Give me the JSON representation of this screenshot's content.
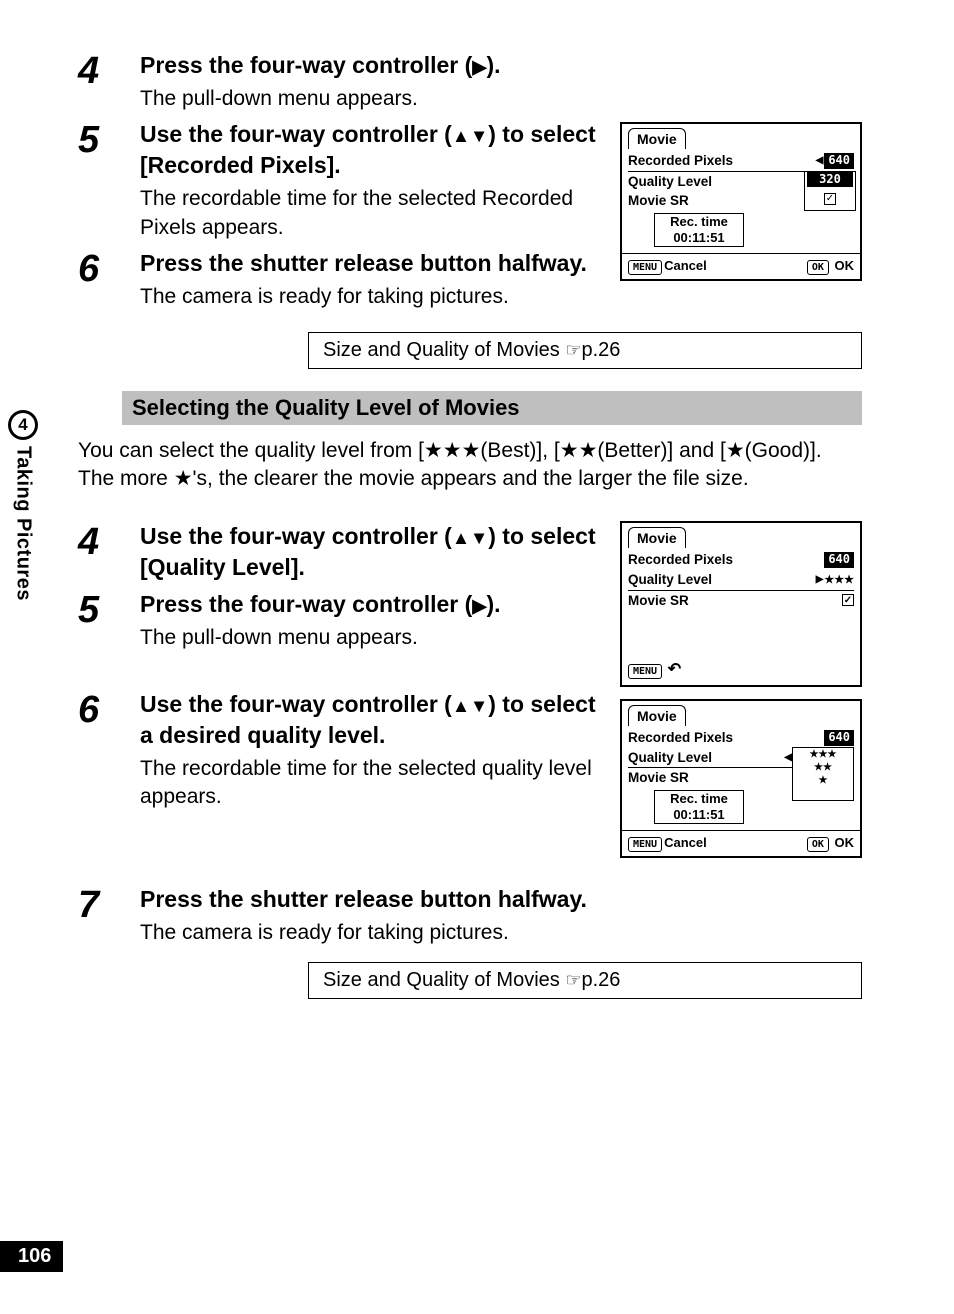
{
  "page_number": "106",
  "side_tab": {
    "number": "4",
    "text": "Taking Pictures"
  },
  "section1": {
    "steps": [
      {
        "num": "4",
        "head_pre": "Press the four-way controller (",
        "head_glyphs": [
          "▶"
        ],
        "head_post": ").",
        "desc": "The pull-down menu appears."
      },
      {
        "num": "5",
        "head_pre": "Use the four-way controller (",
        "head_glyphs": [
          "▲",
          "▼"
        ],
        "head_post": ") to select [Recorded Pixels].",
        "desc": "The recordable time for the selected Recorded Pixels appears."
      },
      {
        "num": "6",
        "head_pre": "Press the shutter release button halfway.",
        "head_glyphs": [],
        "head_post": "",
        "desc": "The camera is ready for taking pictures."
      }
    ],
    "ref": {
      "label": "Size and Quality of Movies ",
      "page": "p.26"
    }
  },
  "lcd_a": {
    "tab": "Movie",
    "row1": {
      "label": "Recorded Pixels",
      "left_arrow": "◀",
      "val_hl": "640"
    },
    "row2": {
      "label": "Quality Level",
      "val_box": "320"
    },
    "row3": {
      "label": "Movie SR",
      "check": true
    },
    "rec": {
      "line1": "Rec. time",
      "line2": "00:11:51"
    },
    "footer": {
      "left_btn": "MENU",
      "left_text": "Cancel",
      "right_btn": "OK",
      "right_text": "OK"
    }
  },
  "section_header": "Selecting the Quality Level of Movies",
  "intro_pre": "You can select the quality level from [",
  "intro_mid1": "(Best)], [",
  "intro_mid2": "(Better)] and [",
  "intro_mid3": "(Good)]. The more ",
  "intro_end": "'s, the clearer the movie appears and the larger the file size.",
  "intro_stars": {
    "best": "★★★",
    "better": "★★",
    "good": "★",
    "single": "★"
  },
  "section2": {
    "steps": [
      {
        "num": "4",
        "head_pre": "Use the four-way controller (",
        "head_glyphs": [
          "▲",
          "▼"
        ],
        "head_post": ") to select [Quality Level].",
        "desc": ""
      },
      {
        "num": "5",
        "head_pre": "Press the four-way controller (",
        "head_glyphs": [
          "▶"
        ],
        "head_post": ").",
        "desc": "The pull-down menu appears."
      },
      {
        "num": "6",
        "head_pre": "Use the four-way controller (",
        "head_glyphs": [
          "▲",
          "▼"
        ],
        "head_post": ") to select a desired quality level.",
        "desc": "The recordable time for the selected quality level appears."
      },
      {
        "num": "7",
        "head_pre": "Press the shutter release button halfway.",
        "head_glyphs": [],
        "head_post": "",
        "desc": "The camera is ready for taking pictures."
      }
    ],
    "ref": {
      "label": "Size and Quality of Movies ",
      "page": "p.26"
    }
  },
  "lcd_b": {
    "tab": "Movie",
    "row1": {
      "label": "Recorded Pixels",
      "val_hl": "640"
    },
    "row2": {
      "label": "Quality Level",
      "arrow": "▶",
      "stars": "★★★"
    },
    "row3": {
      "label": "Movie SR",
      "check": true
    },
    "footer": {
      "left_btn": "MENU",
      "back_icon": "↶"
    }
  },
  "lcd_c": {
    "tab": "Movie",
    "row1": {
      "label": "Recorded Pixels",
      "val_hl": "640"
    },
    "row2": {
      "label": "Quality Level",
      "left_arrow": "◀",
      "stars": "★★★"
    },
    "row3": {
      "label": "Movie SR"
    },
    "drop": {
      "opt2": "★★",
      "opt3": "★"
    },
    "rec": {
      "line1": "Rec. time",
      "line2": "00:11:51"
    },
    "footer": {
      "left_btn": "MENU",
      "left_text": "Cancel",
      "right_btn": "OK",
      "right_text": "OK"
    }
  }
}
